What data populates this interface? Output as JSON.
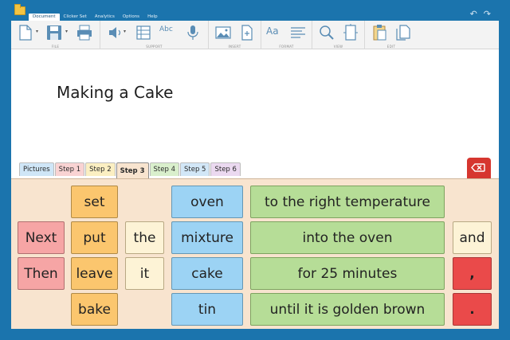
{
  "menu": {
    "items": [
      "Document",
      "Clicker Set",
      "Analytics",
      "Options",
      "Help"
    ],
    "active_index": 0
  },
  "undo_redo": {
    "undo_glyph": "↶",
    "redo_glyph": "↷"
  },
  "ribbon": {
    "groups": [
      {
        "label": "FILE",
        "icons": [
          "new-document-icon",
          "save-icon",
          "print-icon"
        ]
      },
      {
        "label": "SUPPORT",
        "icons": [
          "speaker-icon",
          "word-grid-icon",
          "spellcheck-icon",
          "microphone-icon"
        ]
      },
      {
        "label": "INSERT",
        "icons": [
          "insert-picture-icon",
          "insert-page-icon"
        ]
      },
      {
        "label": "FORMAT",
        "icons": [
          "font-icon",
          "paragraph-icon"
        ]
      },
      {
        "label": "VIEW",
        "icons": [
          "zoom-icon",
          "page-view-icon"
        ]
      },
      {
        "label": "EDIT",
        "icons": [
          "paste-icon",
          "copy-icon"
        ]
      }
    ],
    "format_font_glyph": "Aa",
    "spell_glyph": "Abc"
  },
  "document": {
    "text": "Making a Cake"
  },
  "tabs": [
    {
      "label": "Pictures",
      "color": "#cfe6f7"
    },
    {
      "label": "Step 1",
      "color": "#f9d3d3"
    },
    {
      "label": "Step 2",
      "color": "#fbefc2"
    },
    {
      "label": "Step 3",
      "color": "#f8e4cf"
    },
    {
      "label": "Step 4",
      "color": "#d9efcc"
    },
    {
      "label": "Step 5",
      "color": "#d2e7f7"
    },
    {
      "label": "Step 6",
      "color": "#ebd9f0"
    }
  ],
  "active_tab_index": 3,
  "delete_button": {
    "icon": "backspace-icon"
  },
  "grid": {
    "col1": [
      "Next",
      "Then"
    ],
    "col2": [
      "set",
      "put",
      "leave",
      "bake"
    ],
    "col3": [
      "the",
      "it"
    ],
    "col4": [
      "oven",
      "mixture",
      "cake",
      "tin"
    ],
    "col5": [
      "to the right temperature",
      "into the oven",
      "for 25 minutes",
      "until it is golden brown"
    ],
    "col6": [
      "and",
      ",",
      "."
    ]
  },
  "colors": {
    "accent": "#1b74ad",
    "delete": "#d6362f"
  }
}
